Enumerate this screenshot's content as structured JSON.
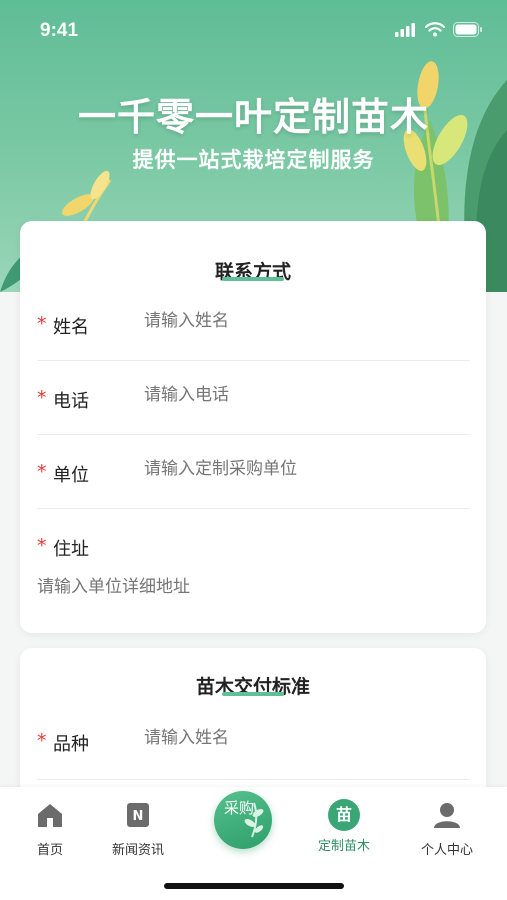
{
  "status_bar": {
    "time": "9:41"
  },
  "hero": {
    "title": "一千零一叶定制苗木",
    "subtitle": "提供一站式栽培定制服务"
  },
  "contact_card": {
    "title": "联系方式",
    "fields": [
      {
        "label": "姓名",
        "placeholder": "请输入姓名",
        "required": "*"
      },
      {
        "label": "电话",
        "placeholder": "请输入电话",
        "required": "*"
      },
      {
        "label": "单位",
        "placeholder": "请输入定制采购单位",
        "required": "*"
      },
      {
        "label": "住址",
        "placeholder": "请输入单位详细地址",
        "required": "*"
      }
    ]
  },
  "delivery_card": {
    "title": "苗木交付标准",
    "fields": [
      {
        "label": "品种",
        "placeholder": "请输入姓名",
        "required": "*"
      }
    ]
  },
  "tabbar": {
    "items": [
      {
        "label": "首页",
        "icon": "home-icon"
      },
      {
        "label": "新闻资讯",
        "icon": "news-icon"
      },
      {
        "label": "采购",
        "icon": "purchase-icon"
      },
      {
        "label": "定制苗木",
        "icon": "seedling-icon",
        "badge": "苗"
      },
      {
        "label": "个人中心",
        "icon": "user-icon"
      }
    ],
    "active": "定制苗木"
  },
  "colors": {
    "primary": "#2f9f6b",
    "hero_bg": "#6cc39d",
    "required": "#e23b3b",
    "placeholder": "#b8b8b8"
  }
}
